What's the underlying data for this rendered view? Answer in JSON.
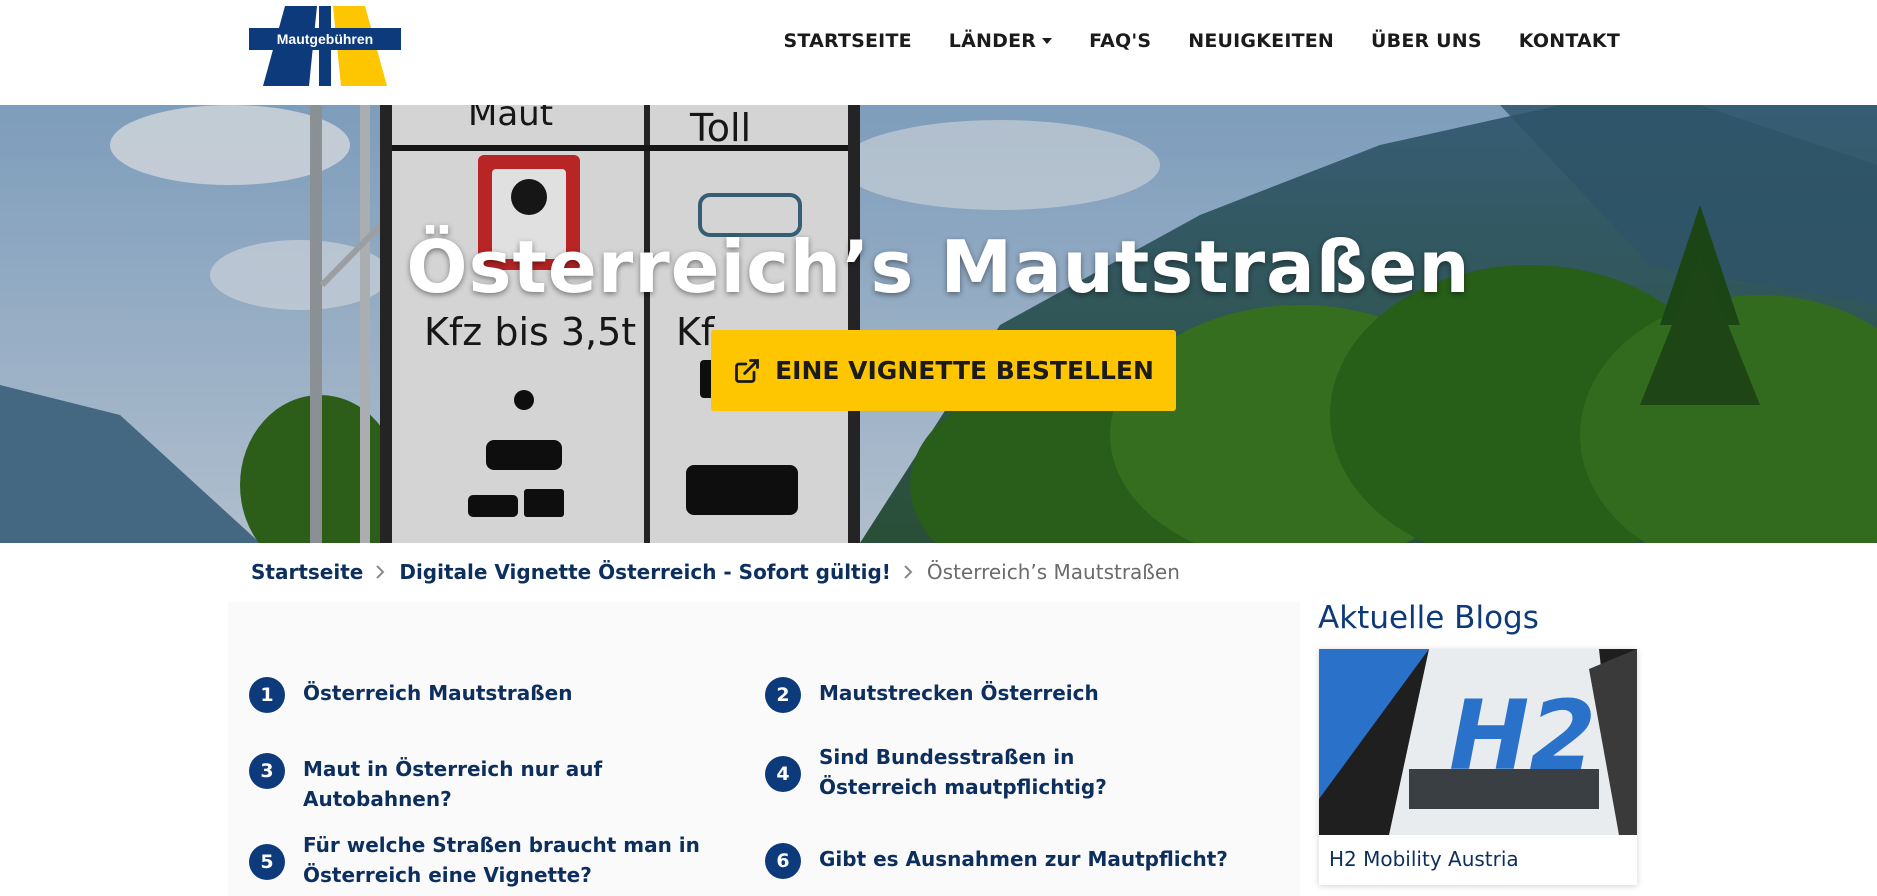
{
  "header": {
    "logo_text": "Mautgebühren",
    "nav": {
      "startseite": "STARTSEITE",
      "laender": "LÄNDER",
      "faqs": "FAQ'S",
      "neuigkeiten": "NEUIGKEITEN",
      "ueber_uns": "ÜBER UNS",
      "kontakt": "KONTAKT"
    }
  },
  "hero": {
    "title": "Österreich’s Mautstraßen",
    "cta_label": "EINE VIGNETTE BESTELLEN",
    "sign_text": {
      "maut": "Maut",
      "toll": "Toll",
      "kfz": "Kfz bis 3,5t",
      "kfz2": "Kf"
    }
  },
  "breadcrumb": {
    "home": "Startseite",
    "parent": "Digitale Vignette Österreich - Sofort gültig!",
    "current": "Österreich’s Mautstraßen"
  },
  "toc": {
    "items": [
      {
        "num": "1",
        "text": "Österreich Mautstraßen"
      },
      {
        "num": "2",
        "text": "Mautstrecken Österreich"
      },
      {
        "num": "3",
        "text": "Maut in Österreich nur auf Autobahnen?"
      },
      {
        "num": "4",
        "text": "Sind Bundesstraßen in Österreich mautpflichtig?"
      },
      {
        "num": "5",
        "text": "Für welche Straßen braucht man in Österreich eine Vignette?"
      },
      {
        "num": "6",
        "text": "Gibt es Ausnahmen zur Mautpflicht?"
      }
    ]
  },
  "sidebar": {
    "title": "Aktuelle Blogs",
    "blog": {
      "caption": "H2 Mobility Austria",
      "image_text": "H2"
    }
  },
  "colors": {
    "brand_blue": "#0d3a7a",
    "accent_yellow": "#fdc600",
    "link": "#0d2f5e"
  }
}
